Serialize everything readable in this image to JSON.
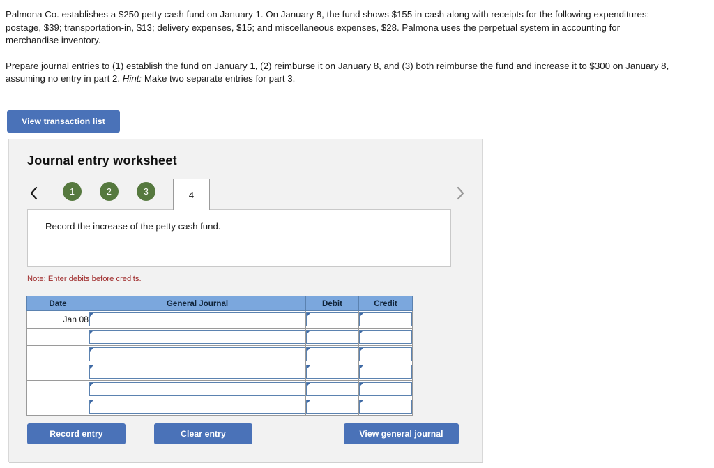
{
  "problem": {
    "paragraph1": "Palmona Co. establishes a $250 petty cash fund on January 1. On January 8, the fund shows $155 in cash along with receipts for the following expenditures: postage, $39; transportation-in, $13; delivery expenses, $15; and miscellaneous expenses, $28. Palmona uses the perpetual system in accounting for merchandise inventory.",
    "paragraph2_before_hint": "Prepare journal entries to (1) establish the fund on January 1, (2) reimburse it on January 8, and (3) both reimburse the fund and increase it to $300 on January 8, assuming no entry in part 2. ",
    "hint_label": "Hint:",
    "paragraph2_after_hint": " Make two separate entries for part 3."
  },
  "toolbar": {
    "view_transaction_list_label": "View transaction list"
  },
  "panel": {
    "title": "Journal entry worksheet",
    "tabs": {
      "prev_icon": "chevron-left-icon",
      "next_icon": "chevron-right-icon",
      "items": [
        {
          "label": "1",
          "state": "completed"
        },
        {
          "label": "2",
          "state": "completed"
        },
        {
          "label": "3",
          "state": "completed"
        },
        {
          "label": "4",
          "state": "active"
        }
      ]
    },
    "prompt": "Record the increase of the petty cash fund.",
    "note": "Note: Enter debits before credits.",
    "table": {
      "headers": [
        "Date",
        "General Journal",
        "Debit",
        "Credit"
      ],
      "rows": [
        {
          "date": "Jan 08",
          "general_journal": "",
          "debit": "",
          "credit": ""
        },
        {
          "date": "",
          "general_journal": "",
          "debit": "",
          "credit": ""
        },
        {
          "date": "",
          "general_journal": "",
          "debit": "",
          "credit": ""
        },
        {
          "date": "",
          "general_journal": "",
          "debit": "",
          "credit": ""
        },
        {
          "date": "",
          "general_journal": "",
          "debit": "",
          "credit": ""
        },
        {
          "date": "",
          "general_journal": "",
          "debit": "",
          "credit": ""
        }
      ]
    },
    "buttons": {
      "record_entry": "Record entry",
      "clear_entry": "Clear entry",
      "view_general_journal": "View general journal"
    }
  },
  "colors": {
    "button_blue": "#4a72b8",
    "tab_green": "#56793f",
    "table_header_blue": "#7ba7dd",
    "note_red": "#9e2828",
    "panel_bg": "#f2f2f2"
  }
}
